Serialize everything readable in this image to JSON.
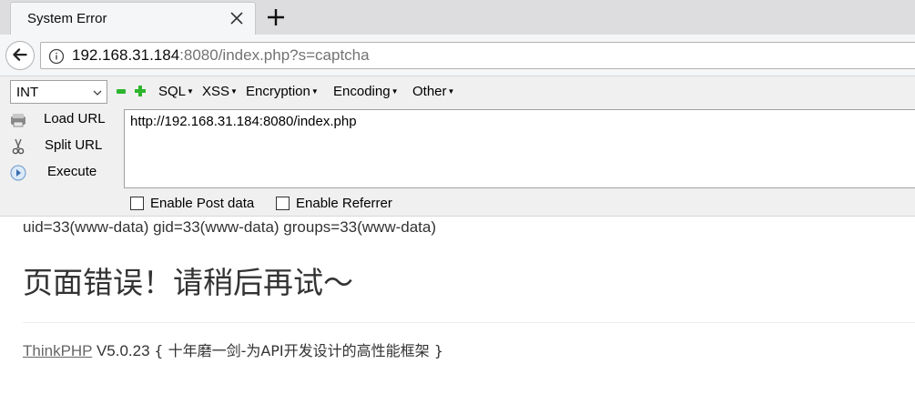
{
  "browser": {
    "tab": {
      "title": "System Error",
      "close_icon": "close-icon"
    },
    "new_tab_icon": "plus-icon",
    "back_icon": "back-arrow-icon",
    "url": {
      "host": "192.168.31.184",
      "rest": ":8080/index.php?s=captcha",
      "info_icon": "info-icon"
    }
  },
  "hackbar": {
    "select_value": "INT",
    "menus": [
      "SQL",
      "XSS",
      "Encryption",
      "Encoding",
      "Other"
    ],
    "actions": [
      {
        "label": "Load URL",
        "icon": "load-url-icon"
      },
      {
        "label": "Split URL",
        "icon": "scissors-icon"
      },
      {
        "label": "Execute",
        "icon": "play-icon"
      }
    ],
    "textarea_value": "http://192.168.31.184:8080/index.php",
    "checkboxes": [
      {
        "label": "Enable Post data",
        "checked": false
      },
      {
        "label": "Enable Referrer",
        "checked": false
      }
    ]
  },
  "page": {
    "command_output": "uid=33(www-data) gid=33(www-data) groups=33(www-data)",
    "error_title": "页面错误！请稍后再试～",
    "footer": {
      "link": "ThinkPHP",
      "version": "V5.0.23",
      "slogan": "{ 十年磨一剑-为API开发设计的高性能框架 }"
    }
  }
}
